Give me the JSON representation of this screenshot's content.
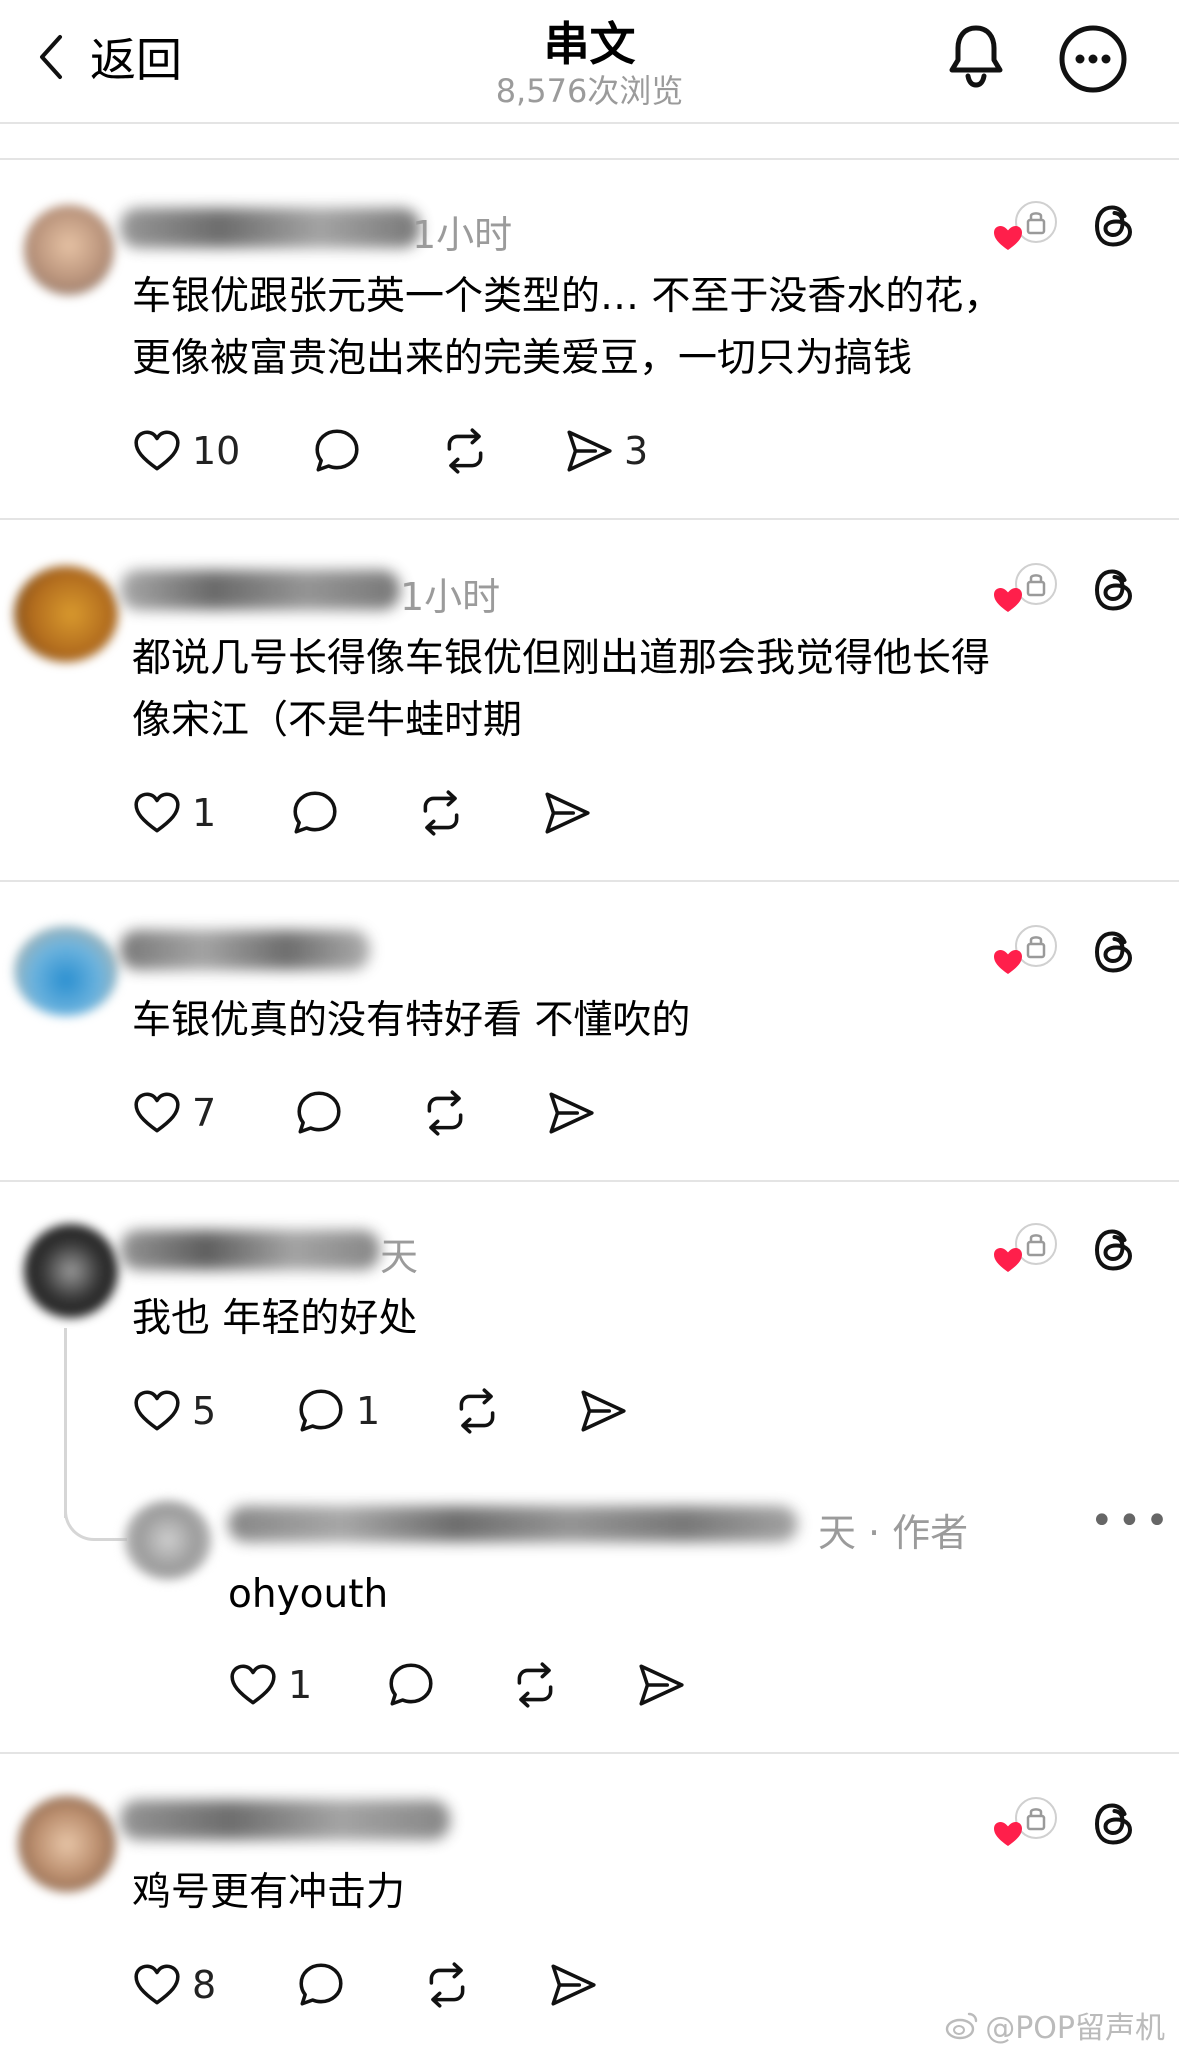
{
  "header": {
    "back_label": "返回",
    "title": "串文",
    "views": "8,576次浏览",
    "icons": [
      "chevron-left-icon",
      "bell-icon",
      "more-icon"
    ]
  },
  "posts": [
    {
      "time_fragment": "1小时",
      "text": "车银优跟张元英一个类型的… 不至于没香水的花，\n更像被富贵泡出来的完美爱豆，一切只为搞钱",
      "likes": "10",
      "replies": "",
      "shares": "3"
    },
    {
      "time_fragment": "1小时",
      "text": "都说几号长得像车银优但刚出道那会我觉得他长得\n像宋江（不是牛蛙时期",
      "likes": "1",
      "replies": "",
      "shares": ""
    },
    {
      "time_fragment": "",
      "text": "车银优真的没有特好看 不懂吹的",
      "likes": "7",
      "replies": "",
      "shares": ""
    },
    {
      "time_fragment": "天",
      "text": "我也 年轻的好处",
      "likes": "5",
      "replies": "1",
      "shares": ""
    },
    {
      "time_fragment": "",
      "text": "鸡号更有冲击力",
      "likes": "8",
      "replies": "",
      "shares": ""
    }
  ],
  "reply": {
    "time_fragment": "天",
    "author_tag": "· 作者",
    "more": "•••",
    "text": "ohyouth",
    "likes": "1",
    "replies": "",
    "shares": ""
  },
  "watermark": "@POP留声机",
  "colors": {
    "heart": "#ff1f4b",
    "muted": "#9b9b9b",
    "divider": "#e4e4e4"
  }
}
